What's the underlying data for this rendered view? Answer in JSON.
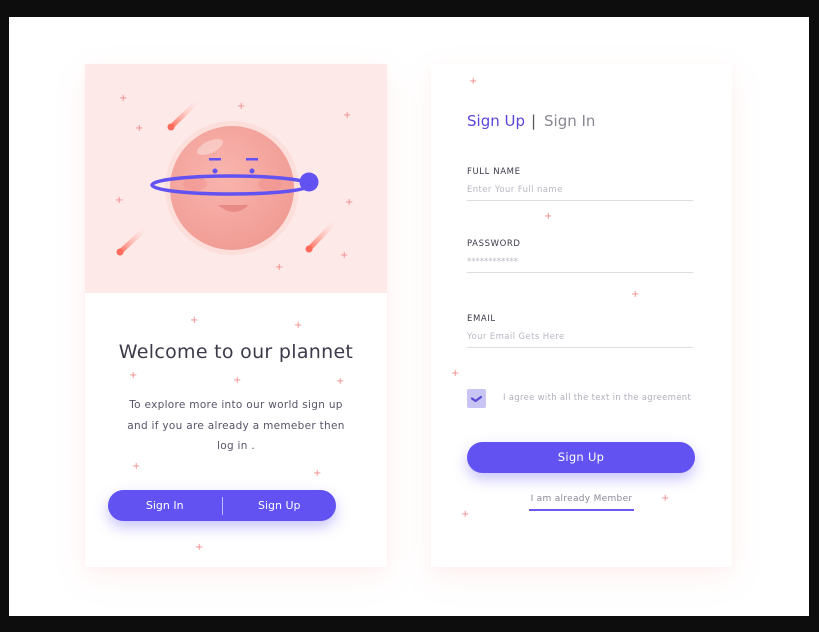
{
  "welcome": {
    "title": "Welcome to our plannet",
    "line1": "To explore more into our world sign up",
    "line2": "and if you are already a memeber then",
    "line3": "log in ."
  },
  "toggle": {
    "signin_label": "Sign In",
    "signup_label": "Sign Up"
  },
  "form": {
    "tab_signup": "Sign Up",
    "tab_separator": "|",
    "tab_signin": "Sign In",
    "fullname_label": "FULL NAME",
    "fullname_placeholder": "Enter Your Full name",
    "password_label": "PASSWORD",
    "password_value": "************",
    "email_label": "EMAIL",
    "email_placeholder": "Your Email Gets Here",
    "agree_text": "I agree with all the text in the agreement",
    "agree_checked": true,
    "submit_label": "Sign Up",
    "member_link": "I am already Member"
  },
  "colors": {
    "accent": "#6252f2",
    "planet": "#f6aaa4",
    "illustration_bg": "#fde9e8",
    "sparkle": "#f08a8a"
  },
  "icons": {
    "checkbox_mark": "check-icon",
    "sparkle": "sparkle-icon"
  }
}
